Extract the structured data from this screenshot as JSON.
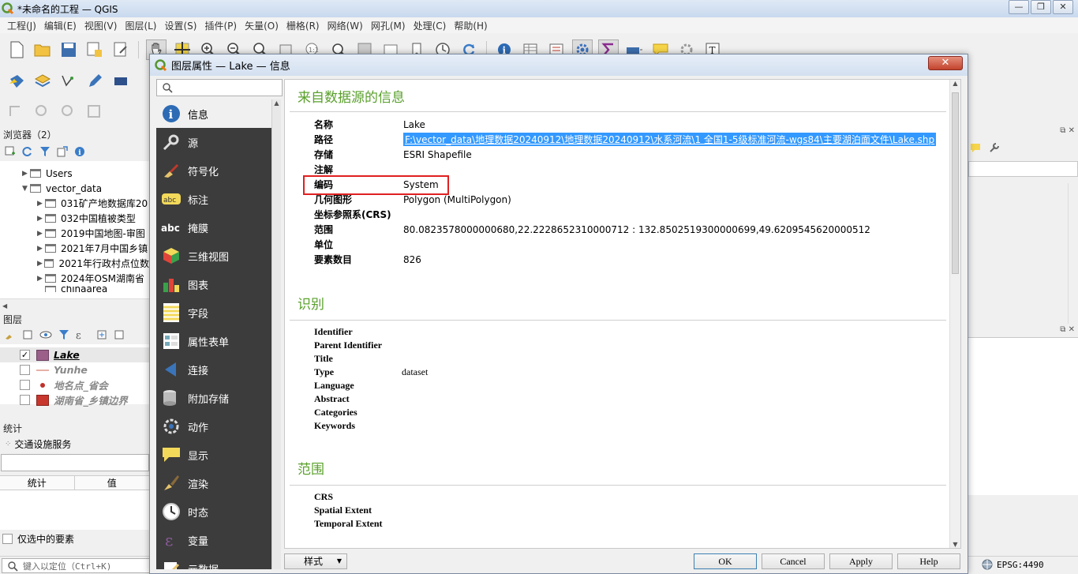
{
  "window": {
    "title": "*未命名的工程 — QGIS",
    "min": "—",
    "max": "❐",
    "close": "✕"
  },
  "menu": [
    "工程(J)",
    "编辑(E)",
    "视图(V)",
    "图层(L)",
    "设置(S)",
    "插件(P)",
    "矢量(O)",
    "栅格(R)",
    "网络(W)",
    "网孔(M)",
    "处理(C)",
    "帮助(H)"
  ],
  "browser": {
    "title": "浏览器（2）",
    "items": [
      "Users",
      "vector_data",
      "031矿产地数据库20",
      "032中国植被类型",
      "2019中国地图-审图",
      "2021年7月中国乡镇",
      "2021年行政村点位数",
      "2024年OSM湖南省",
      "chinaarea"
    ]
  },
  "layers": {
    "title": "图层",
    "items": [
      {
        "name": "Lake",
        "checked": "✓",
        "color": "#9b5f8a"
      },
      {
        "name": "Yunhe",
        "checked": "",
        "color": "#e8b0a6"
      },
      {
        "name": "地名点_省会",
        "checked": "",
        "color": "#c0302a"
      },
      {
        "name": "湖南省_乡镇边界",
        "checked": "",
        "color": "#c8372e"
      }
    ]
  },
  "stats": {
    "title": "统计",
    "service": "交通设施服务",
    "col_stat": "统计",
    "col_value": "值",
    "only_selected": "仅选中的要素"
  },
  "statusbar": {
    "locator_placeholder": "键入以定位（Ctrl+K)",
    "crs": "EPSG:4490"
  },
  "dialog": {
    "title": "图层属性 — Lake — 信息",
    "close": "✕",
    "nav": [
      {
        "label": "信息",
        "icon": "info-icon"
      },
      {
        "label": "源",
        "icon": "source-icon"
      },
      {
        "label": "符号化",
        "icon": "symbology-icon"
      },
      {
        "label": "标注",
        "icon": "labels-icon"
      },
      {
        "label": "掩膜",
        "icon": "mask-icon"
      },
      {
        "label": "三维视图",
        "icon": "3d-view-icon"
      },
      {
        "label": "图表",
        "icon": "diagram-icon"
      },
      {
        "label": "字段",
        "icon": "fields-icon"
      },
      {
        "label": "属性表单",
        "icon": "attributes-form-icon"
      },
      {
        "label": "连接",
        "icon": "joins-icon"
      },
      {
        "label": "附加存储",
        "icon": "auxiliary-storage-icon"
      },
      {
        "label": "动作",
        "icon": "actions-icon"
      },
      {
        "label": "显示",
        "icon": "display-icon"
      },
      {
        "label": "渲染",
        "icon": "rendering-icon"
      },
      {
        "label": "时态",
        "icon": "temporal-icon"
      },
      {
        "label": "变量",
        "icon": "variables-icon"
      },
      {
        "label": "元数据",
        "icon": "metadata-icon"
      }
    ],
    "sections": {
      "source_info": "来自数据源的信息",
      "identification": "识别",
      "extent": "范围"
    },
    "info": [
      {
        "k": "名称",
        "v": "Lake"
      },
      {
        "k": "路径",
        "v": "F:\\vector_data\\地理数据20240912\\地理数据20240912\\水系河流\\1 全国1-5级标准河流-wgs84\\主要湖泊面文件\\Lake.shp"
      },
      {
        "k": "存储",
        "v": "ESRI Shapefile"
      },
      {
        "k": "注解",
        "v": ""
      },
      {
        "k": "编码",
        "v": "System"
      },
      {
        "k": "几何图形",
        "v": "Polygon (MultiPolygon)"
      },
      {
        "k": "坐标参照系(CRS)",
        "v": ""
      },
      {
        "k": "范围",
        "v": "80.0823578000000680,22.2228652310000712 : 132.8502519300000699,49.6209545620000512"
      },
      {
        "k": "单位",
        "v": ""
      },
      {
        "k": "要素数目",
        "v": "826"
      }
    ],
    "ident": [
      {
        "k": "Identifier",
        "v": ""
      },
      {
        "k": "Parent Identifier",
        "v": ""
      },
      {
        "k": "Title",
        "v": ""
      },
      {
        "k": "Type",
        "v": "dataset"
      },
      {
        "k": "Language",
        "v": ""
      },
      {
        "k": "Abstract",
        "v": ""
      },
      {
        "k": "Categories",
        "v": ""
      },
      {
        "k": "Keywords",
        "v": ""
      }
    ],
    "extent": [
      {
        "k": "CRS",
        "v": ""
      },
      {
        "k": "Spatial Extent",
        "v": ""
      },
      {
        "k": "Temporal Extent",
        "v": ""
      }
    ],
    "buttons": {
      "style": "样式",
      "ok": "OK",
      "cancel": "Cancel",
      "apply": "Apply",
      "help": "Help"
    }
  }
}
